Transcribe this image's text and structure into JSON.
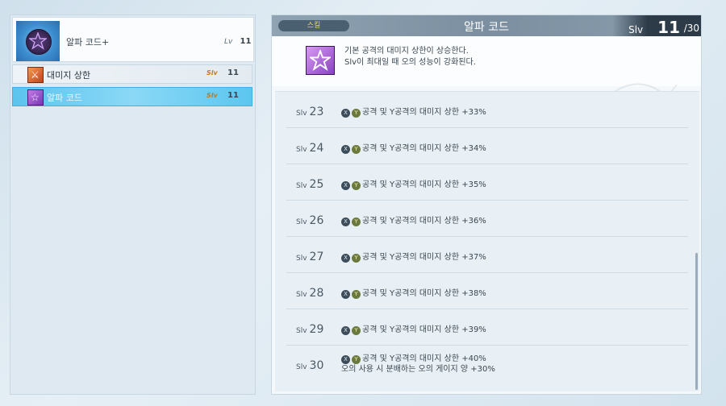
{
  "character": {
    "name": "알파 코드+",
    "level_label": "Lv",
    "level_value": "11"
  },
  "skills": [
    {
      "name": "대미지 상한",
      "slv_label": "Slv",
      "slv_value": "11",
      "icon": "sword-icon",
      "selected": false
    },
    {
      "name": "알파 코드",
      "slv_label": "Slv",
      "slv_value": "11",
      "icon": "star-icon",
      "selected": true
    }
  ],
  "detail": {
    "tag": "스킬",
    "title": "알파 코드",
    "slv_label": "Slv",
    "slv_current": "11",
    "slv_max": "/30",
    "desc_line1": "기본 공격의 대미지 상한이 상승한다.",
    "desc_line2": "Slv이 최대일 때 오의 성능이 강화된다."
  },
  "levels": [
    {
      "pre": "Slv",
      "num": "23",
      "effect": "공격 및 Y공격의 대미지 상한 +33%"
    },
    {
      "pre": "Slv",
      "num": "24",
      "effect": "공격 및 Y공격의 대미지 상한 +34%"
    },
    {
      "pre": "Slv",
      "num": "25",
      "effect": "공격 및 Y공격의 대미지 상한 +35%"
    },
    {
      "pre": "Slv",
      "num": "26",
      "effect": "공격 및 Y공격의 대미지 상한 +36%"
    },
    {
      "pre": "Slv",
      "num": "27",
      "effect": "공격 및 Y공격의 대미지 상한 +37%"
    },
    {
      "pre": "Slv",
      "num": "28",
      "effect": "공격 및 Y공격의 대미지 상한 +38%"
    },
    {
      "pre": "Slv",
      "num": "29",
      "effect": "공격 및 Y공격의 대미지 상한 +39%"
    },
    {
      "pre": "Slv",
      "num": "30",
      "effect": "공격 및 Y공격의 대미지 상한 +40%",
      "effect2": "오의 사용 시 분배하는 오의 게이지 양 +30%"
    }
  ],
  "buttons": {
    "x": "X",
    "y": "Y"
  },
  "colors": {
    "accent": "#5cc4ee",
    "header": "#7b8fa0",
    "slv_accent": "#c27a1c"
  }
}
